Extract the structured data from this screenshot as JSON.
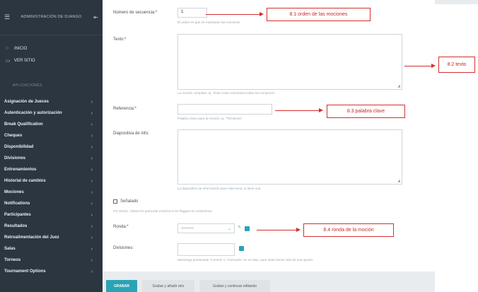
{
  "sidebar": {
    "title": "ADMINISTRACIÓN DE DJANGO",
    "links": [
      {
        "icon": "circle-icon",
        "label": "INICIO"
      },
      {
        "icon": "monitor-icon",
        "label": "VER SITIO"
      }
    ],
    "section_label": "APLICACIONES",
    "items": [
      "Asignación de Jueces",
      "Autenticación y autorización",
      "Break Qualification",
      "Cheques",
      "Disponibilidad",
      "Divisiones",
      "Entrenamientos",
      "Historial de cambios",
      "Mociones",
      "Notifications",
      "Participantes",
      "Resultados",
      "Retroalimentación del Juez",
      "Salas",
      "Torneos",
      "Tournament Options"
    ]
  },
  "form": {
    "seq_label": "Número de secuencia:*",
    "seq_value": "1",
    "seq_help": "El orden en que se mostrarán las mociones",
    "texto_label": "Texto:*",
    "texto_help": "La moción completa, ej. \"Esta Casa exoneraría todos los tornames\"",
    "ref_label": "Referencia:*",
    "ref_help": "Palabra clave para la moción, ej. \"Tornames\"",
    "info_label": "Diapositiva de info:",
    "info_help": "La diapositiva de información para este tema, si tiene una",
    "flagged_label": "Señalado",
    "flagged_help": "For WADL: Allows for particular motions to be flagged as contentious",
    "ronda_label": "Ronda:*",
    "ronda_value": "---------",
    "div_label": "Divisiones:",
    "div_help": "Mantenga presionado \"Control\" o \"Comando\" en un Mac, para seleccionar más de una opción."
  },
  "buttons": {
    "save": "GRABAR",
    "save_add": "Grabar y añadir otro",
    "save_continue": "Grabar y continuar editando"
  },
  "annotations": {
    "a1": "8.1 orden de las mociones",
    "a2": "8.2 texto",
    "a3": "8.3 palabra clave",
    "a4": "8.4 ronda de la moción"
  },
  "colors": {
    "sidebar_bg": "#2b3640",
    "primary": "#2aa3b5",
    "annotation": "#d32f2f"
  }
}
